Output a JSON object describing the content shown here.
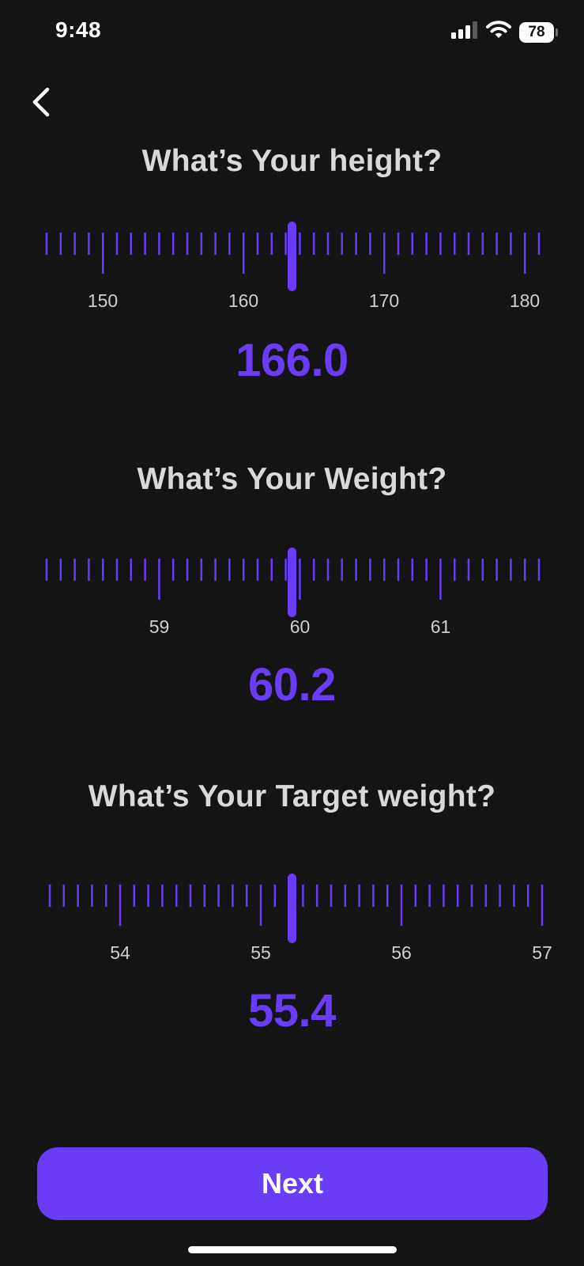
{
  "status_bar": {
    "time": "9:48",
    "battery": "78",
    "icons": [
      "signal-icon",
      "wifi-icon",
      "battery-icon"
    ]
  },
  "nav": {
    "back_icon": "chevron-left-icon"
  },
  "colors": {
    "accent": "#6a3cf5",
    "background": "#141414",
    "question_text": "#d9d9d9",
    "tick_label": "#cfcfcf"
  },
  "height": {
    "question": "What’s Your height?",
    "value": "166.0",
    "ruler_labels": [
      "150",
      "160",
      "170",
      "180"
    ]
  },
  "weight": {
    "question": "What’s Your Weight?",
    "value": "60.2",
    "ruler_labels": [
      "59",
      "60",
      "61"
    ]
  },
  "target_weight": {
    "question": "What’s Your Target weight?",
    "value": "55.4",
    "ruler_labels": [
      "54",
      "55",
      "56",
      "57"
    ]
  },
  "next_button": {
    "label": "Next"
  }
}
